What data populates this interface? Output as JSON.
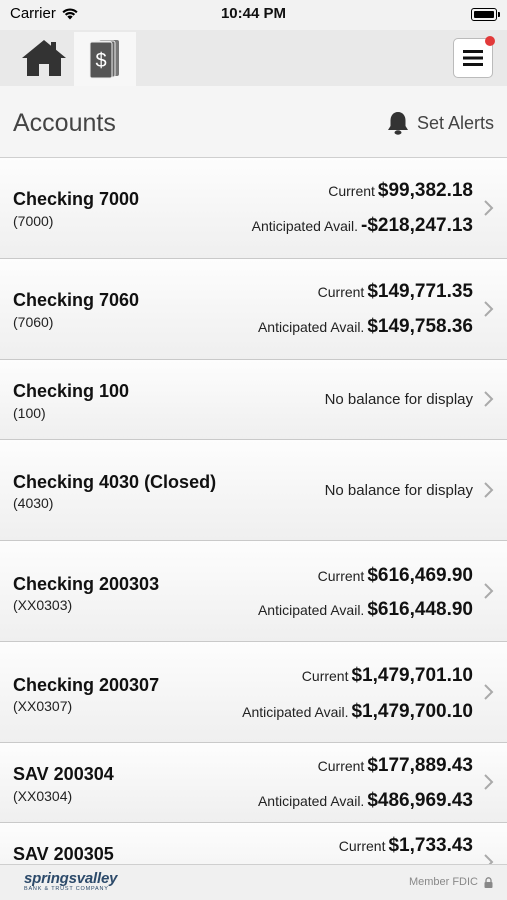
{
  "status_bar": {
    "carrier": "Carrier",
    "time": "10:44 PM"
  },
  "nav": {
    "home_icon": "home-icon",
    "accounts_icon": "dollar-document-icon",
    "menu_icon": "hamburger-icon",
    "notification_color": "#e23a3a"
  },
  "header": {
    "title": "Accounts",
    "alerts_label": "Set Alerts"
  },
  "accounts": [
    {
      "name": "Checking 7000",
      "number": "(7000)",
      "current_label": "Current",
      "current": "$99,382.18",
      "anticipated_label": "Anticipated Avail.",
      "anticipated": "-$218,247.13"
    },
    {
      "name": "Checking 7060",
      "number": "(7060)",
      "current_label": "Current",
      "current": "$149,771.35",
      "anticipated_label": "Anticipated Avail.",
      "anticipated": "$149,758.36"
    },
    {
      "name": "Checking 100",
      "number": "(100)",
      "message": "No balance for display"
    },
    {
      "name": "Checking 4030 (Closed)",
      "number": "(4030)",
      "message": "No balance for display"
    },
    {
      "name": "Checking 200303",
      "number": "(XX0303)",
      "current_label": "Current",
      "current": "$616,469.90",
      "anticipated_label": "Anticipated Avail.",
      "anticipated": "$616,448.90"
    },
    {
      "name": "Checking 200307",
      "number": "(XX0307)",
      "current_label": "Current",
      "current": "$1,479,701.10",
      "anticipated_label": "Anticipated Avail.",
      "anticipated": "$1,479,700.10"
    },
    {
      "name": "SAV 200304",
      "number": "(XX0304)",
      "current_label": "Current",
      "current": "$177,889.43",
      "anticipated_label": "Anticipated Avail.",
      "anticipated": "$486,969.43"
    },
    {
      "name": "SAV 200305",
      "current_label": "Current",
      "current": "$1,733.43"
    }
  ],
  "footer": {
    "brand_name": "springsvalley",
    "brand_sub": "BANK & TRUST COMPANY",
    "fdic": "Member FDIC",
    "lock_icon": "lock-icon"
  }
}
